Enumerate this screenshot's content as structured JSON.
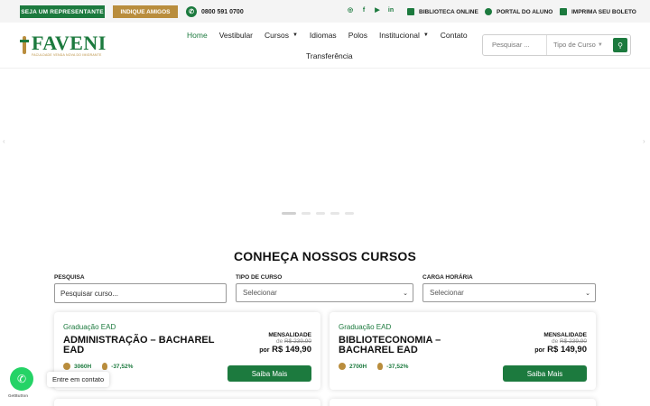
{
  "topbar": {
    "rep_button": "SEJA UM REPRESENTANTE",
    "indique_button": "INDIQUE AMIGOS",
    "phone": "0800 591 0700",
    "socials": [
      "instagram-icon",
      "facebook-icon",
      "youtube-icon",
      "linkedin-icon"
    ],
    "links": [
      {
        "label": "BIBLIOTECA ONLINE",
        "icon": "book-icon"
      },
      {
        "label": "PORTAL DO ALUNO",
        "icon": "user-icon"
      },
      {
        "label": "IMPRIMA SEU BOLETO",
        "icon": "printer-icon"
      }
    ]
  },
  "brand": {
    "name": "FAVENI",
    "tagline": "FACULDADE VENDA NOVA DO IMIGRANTE"
  },
  "nav": {
    "items": [
      {
        "label": "Home",
        "active": true,
        "dropdown": false
      },
      {
        "label": "Vestibular",
        "active": false,
        "dropdown": false
      },
      {
        "label": "Cursos",
        "active": false,
        "dropdown": true
      },
      {
        "label": "Idiomas",
        "active": false,
        "dropdown": false
      },
      {
        "label": "Polos",
        "active": false,
        "dropdown": false
      },
      {
        "label": "Institucional",
        "active": false,
        "dropdown": true
      },
      {
        "label": "Contato",
        "active": false,
        "dropdown": false
      }
    ],
    "second_row": "Transferência"
  },
  "header_search": {
    "placeholder": "Pesquisar ...",
    "type_select": "Tipo de Curso"
  },
  "section": {
    "title": "CONHEÇA NOSSOS CURSOS"
  },
  "filters": {
    "search_label": "PESQUISA",
    "search_placeholder": "Pesquisar curso...",
    "type_label": "TIPO DE CURSO",
    "type_value": "Selecionar",
    "hours_label": "CARGA HORÁRIA",
    "hours_value": "Selecionar"
  },
  "courses": [
    {
      "category": "Graduação EAD",
      "title": "ADMINISTRAÇÃO – BACHAREL EAD",
      "hours": "3060H",
      "discount": "-37,52%",
      "price_label": "MENSALIDADE",
      "old_price_prefix": "de",
      "old_price": "R$ 239,90",
      "new_price_prefix": "por",
      "new_price": "R$ 149,90",
      "cta": "Saiba Mais"
    },
    {
      "category": "Graduação EAD",
      "title": "BIBLIOTECONOMIA – BACHAREL EAD",
      "hours": "2700H",
      "discount": "-37,52%",
      "price_label": "MENSALIDADE",
      "old_price_prefix": "de",
      "old_price": "R$ 239,90",
      "new_price_prefix": "por",
      "new_price": "R$ 149,90",
      "cta": "Saiba Mais"
    }
  ],
  "whatsapp": {
    "bubble": "Entre em contato",
    "credit": "GetButton"
  },
  "colors": {
    "primary": "#1c7a3e",
    "gold": "#b98d3d"
  }
}
